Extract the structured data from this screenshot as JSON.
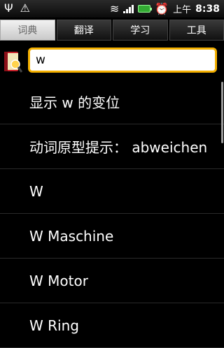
{
  "statusbar": {
    "icons": [
      "usb-icon",
      "warning-icon",
      "wifi-icon",
      "signal-icon",
      "battery-charging-icon",
      "alarm-icon"
    ],
    "ampm": "上午",
    "time": "8:38"
  },
  "tabs": [
    {
      "label": "词典",
      "active": true
    },
    {
      "label": "翻译",
      "active": false
    },
    {
      "label": "学习",
      "active": false
    },
    {
      "label": "工具",
      "active": false
    }
  ],
  "search": {
    "value": "w"
  },
  "results": [
    "显示 w 的变位",
    "动词原型提示： abweichen",
    "W",
    "W Maschine",
    "W Motor",
    "W Ring"
  ],
  "colors": {
    "search_border": "#f4b000",
    "background": "#000000",
    "text": "#ffffff"
  }
}
